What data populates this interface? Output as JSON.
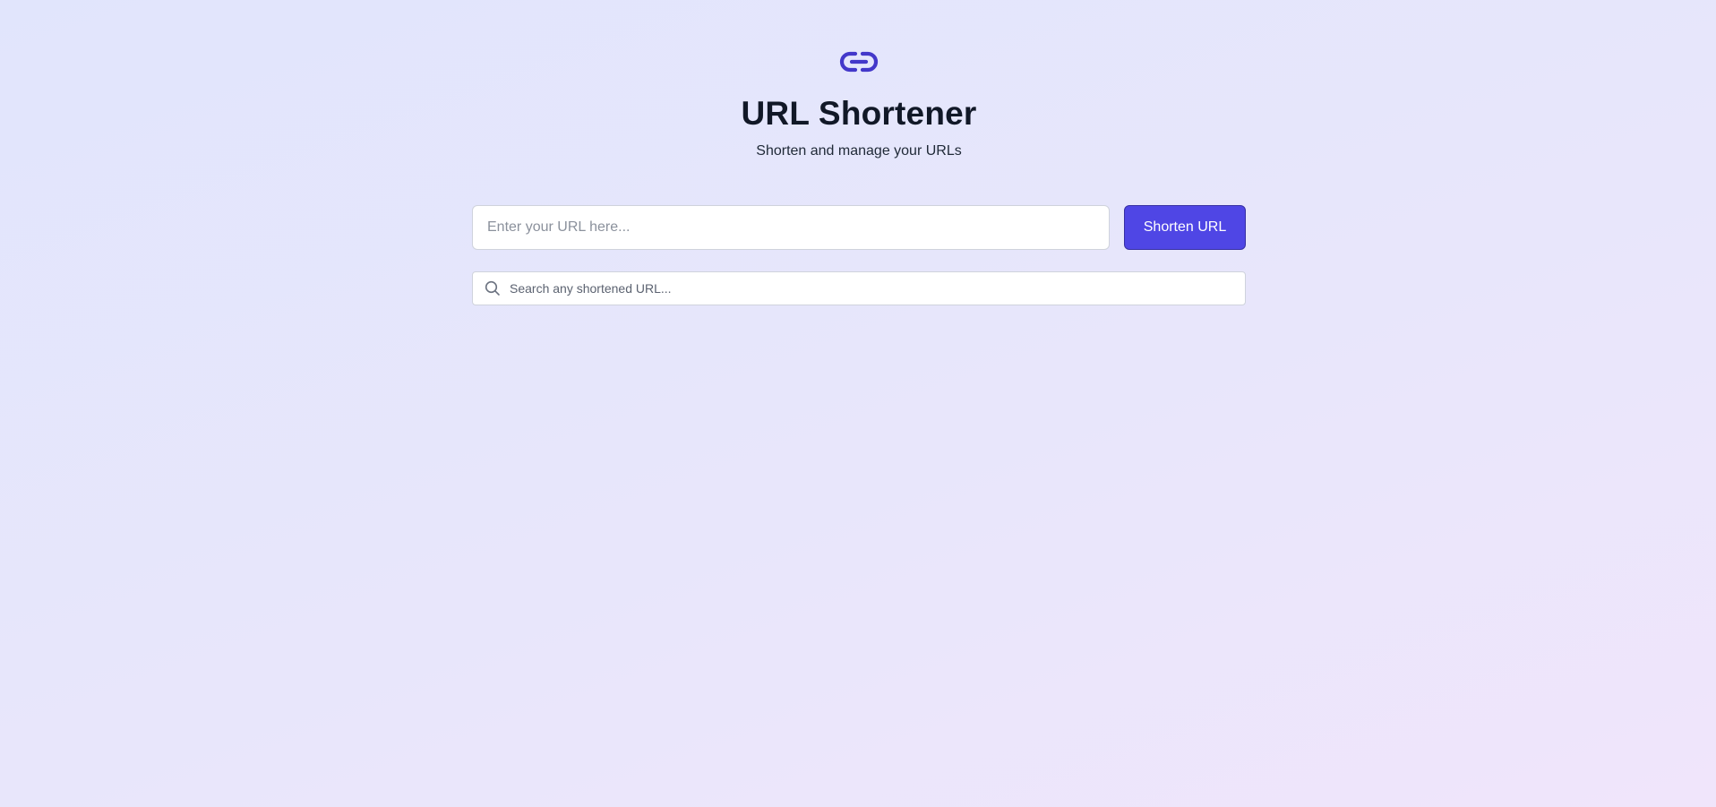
{
  "header": {
    "icon": "link-icon",
    "title": "URL Shortener",
    "subtitle": "Shorten and manage your URLs"
  },
  "shorten_form": {
    "url_value": "",
    "url_placeholder": "Enter your URL here...",
    "button_label": "Shorten URL"
  },
  "search": {
    "icon": "search-icon",
    "value": "",
    "placeholder": "Search any shortened URL..."
  },
  "colors": {
    "accent": "#4f46e5",
    "background_start": "#e1e5fc",
    "background_end": "#f0e5fb"
  }
}
